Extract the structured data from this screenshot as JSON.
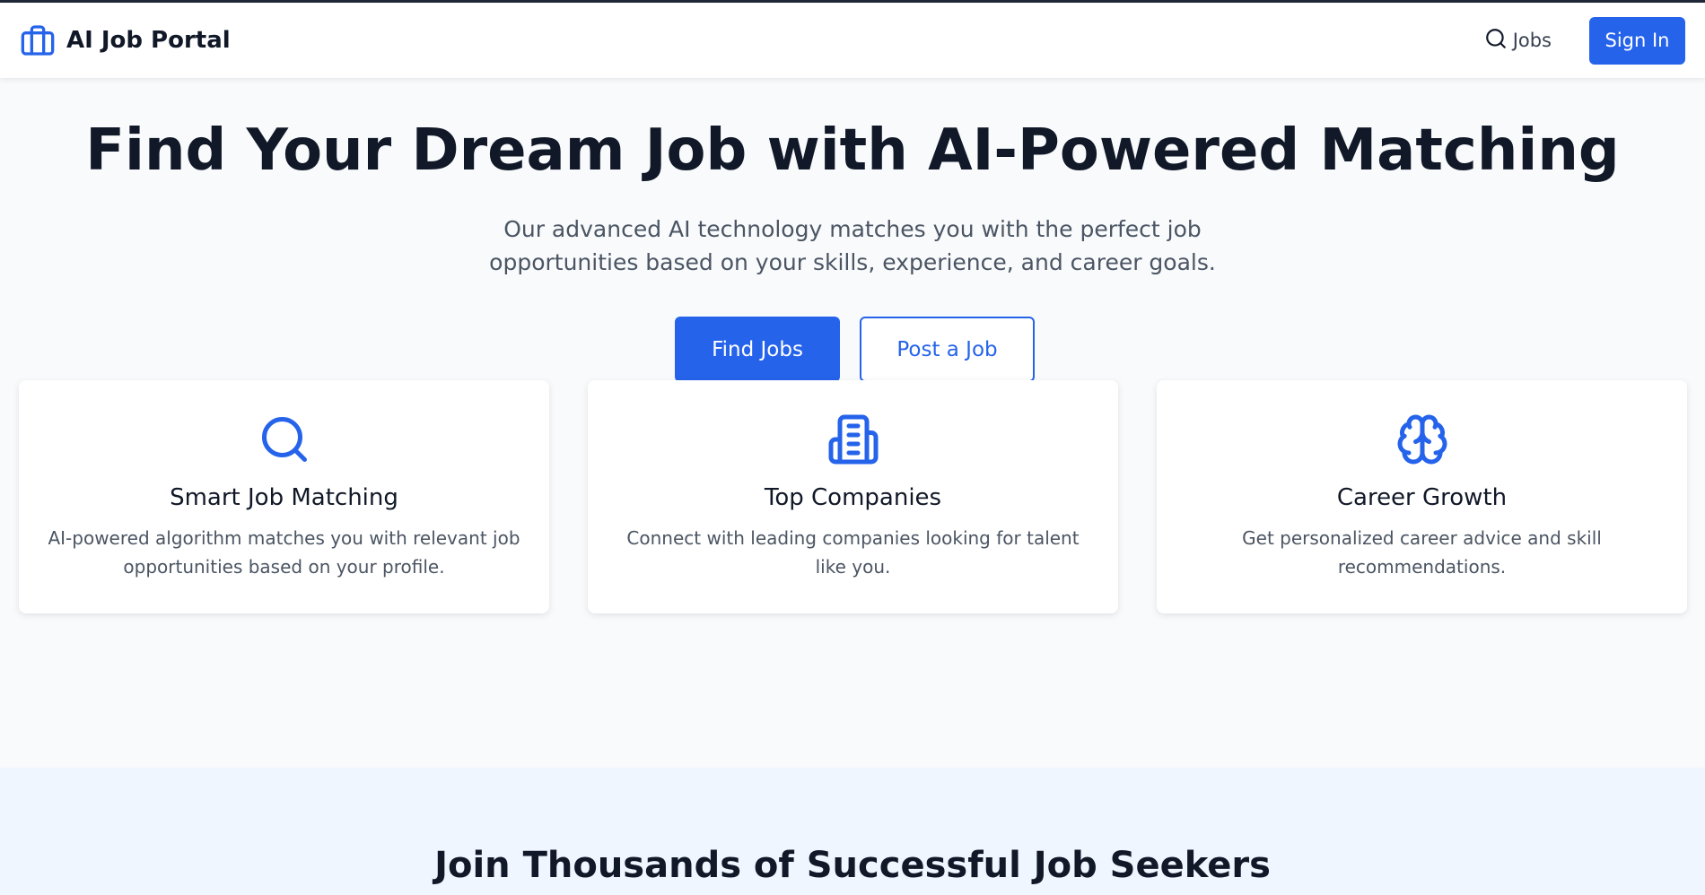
{
  "nav": {
    "brand": "AI Job Portal",
    "jobs_label": "Jobs",
    "signin_label": "Sign In"
  },
  "hero": {
    "title": "Find Your Dream Job with AI-Powered Matching",
    "subtitle": "Our advanced AI technology matches you with the perfect job opportunities based on your skills, experience, and career goals.",
    "find_jobs_label": "Find Jobs",
    "post_job_label": "Post a Job"
  },
  "features": [
    {
      "icon": "search-icon",
      "title": "Smart Job Matching",
      "description": "AI-powered algorithm matches you with relevant job opportunities based on your profile."
    },
    {
      "icon": "building-icon",
      "title": "Top Companies",
      "description": "Connect with leading companies looking for talent like you."
    },
    {
      "icon": "brain-icon",
      "title": "Career Growth",
      "description": "Get personalized career advice and skill recommendations."
    }
  ],
  "join": {
    "title": "Join Thousands of Successful Job Seekers"
  },
  "colors": {
    "accent": "#2563eb",
    "background": "#f8fafc",
    "join_background": "#eff6ff",
    "text_dark": "#111827",
    "text_muted": "#4b5563"
  }
}
